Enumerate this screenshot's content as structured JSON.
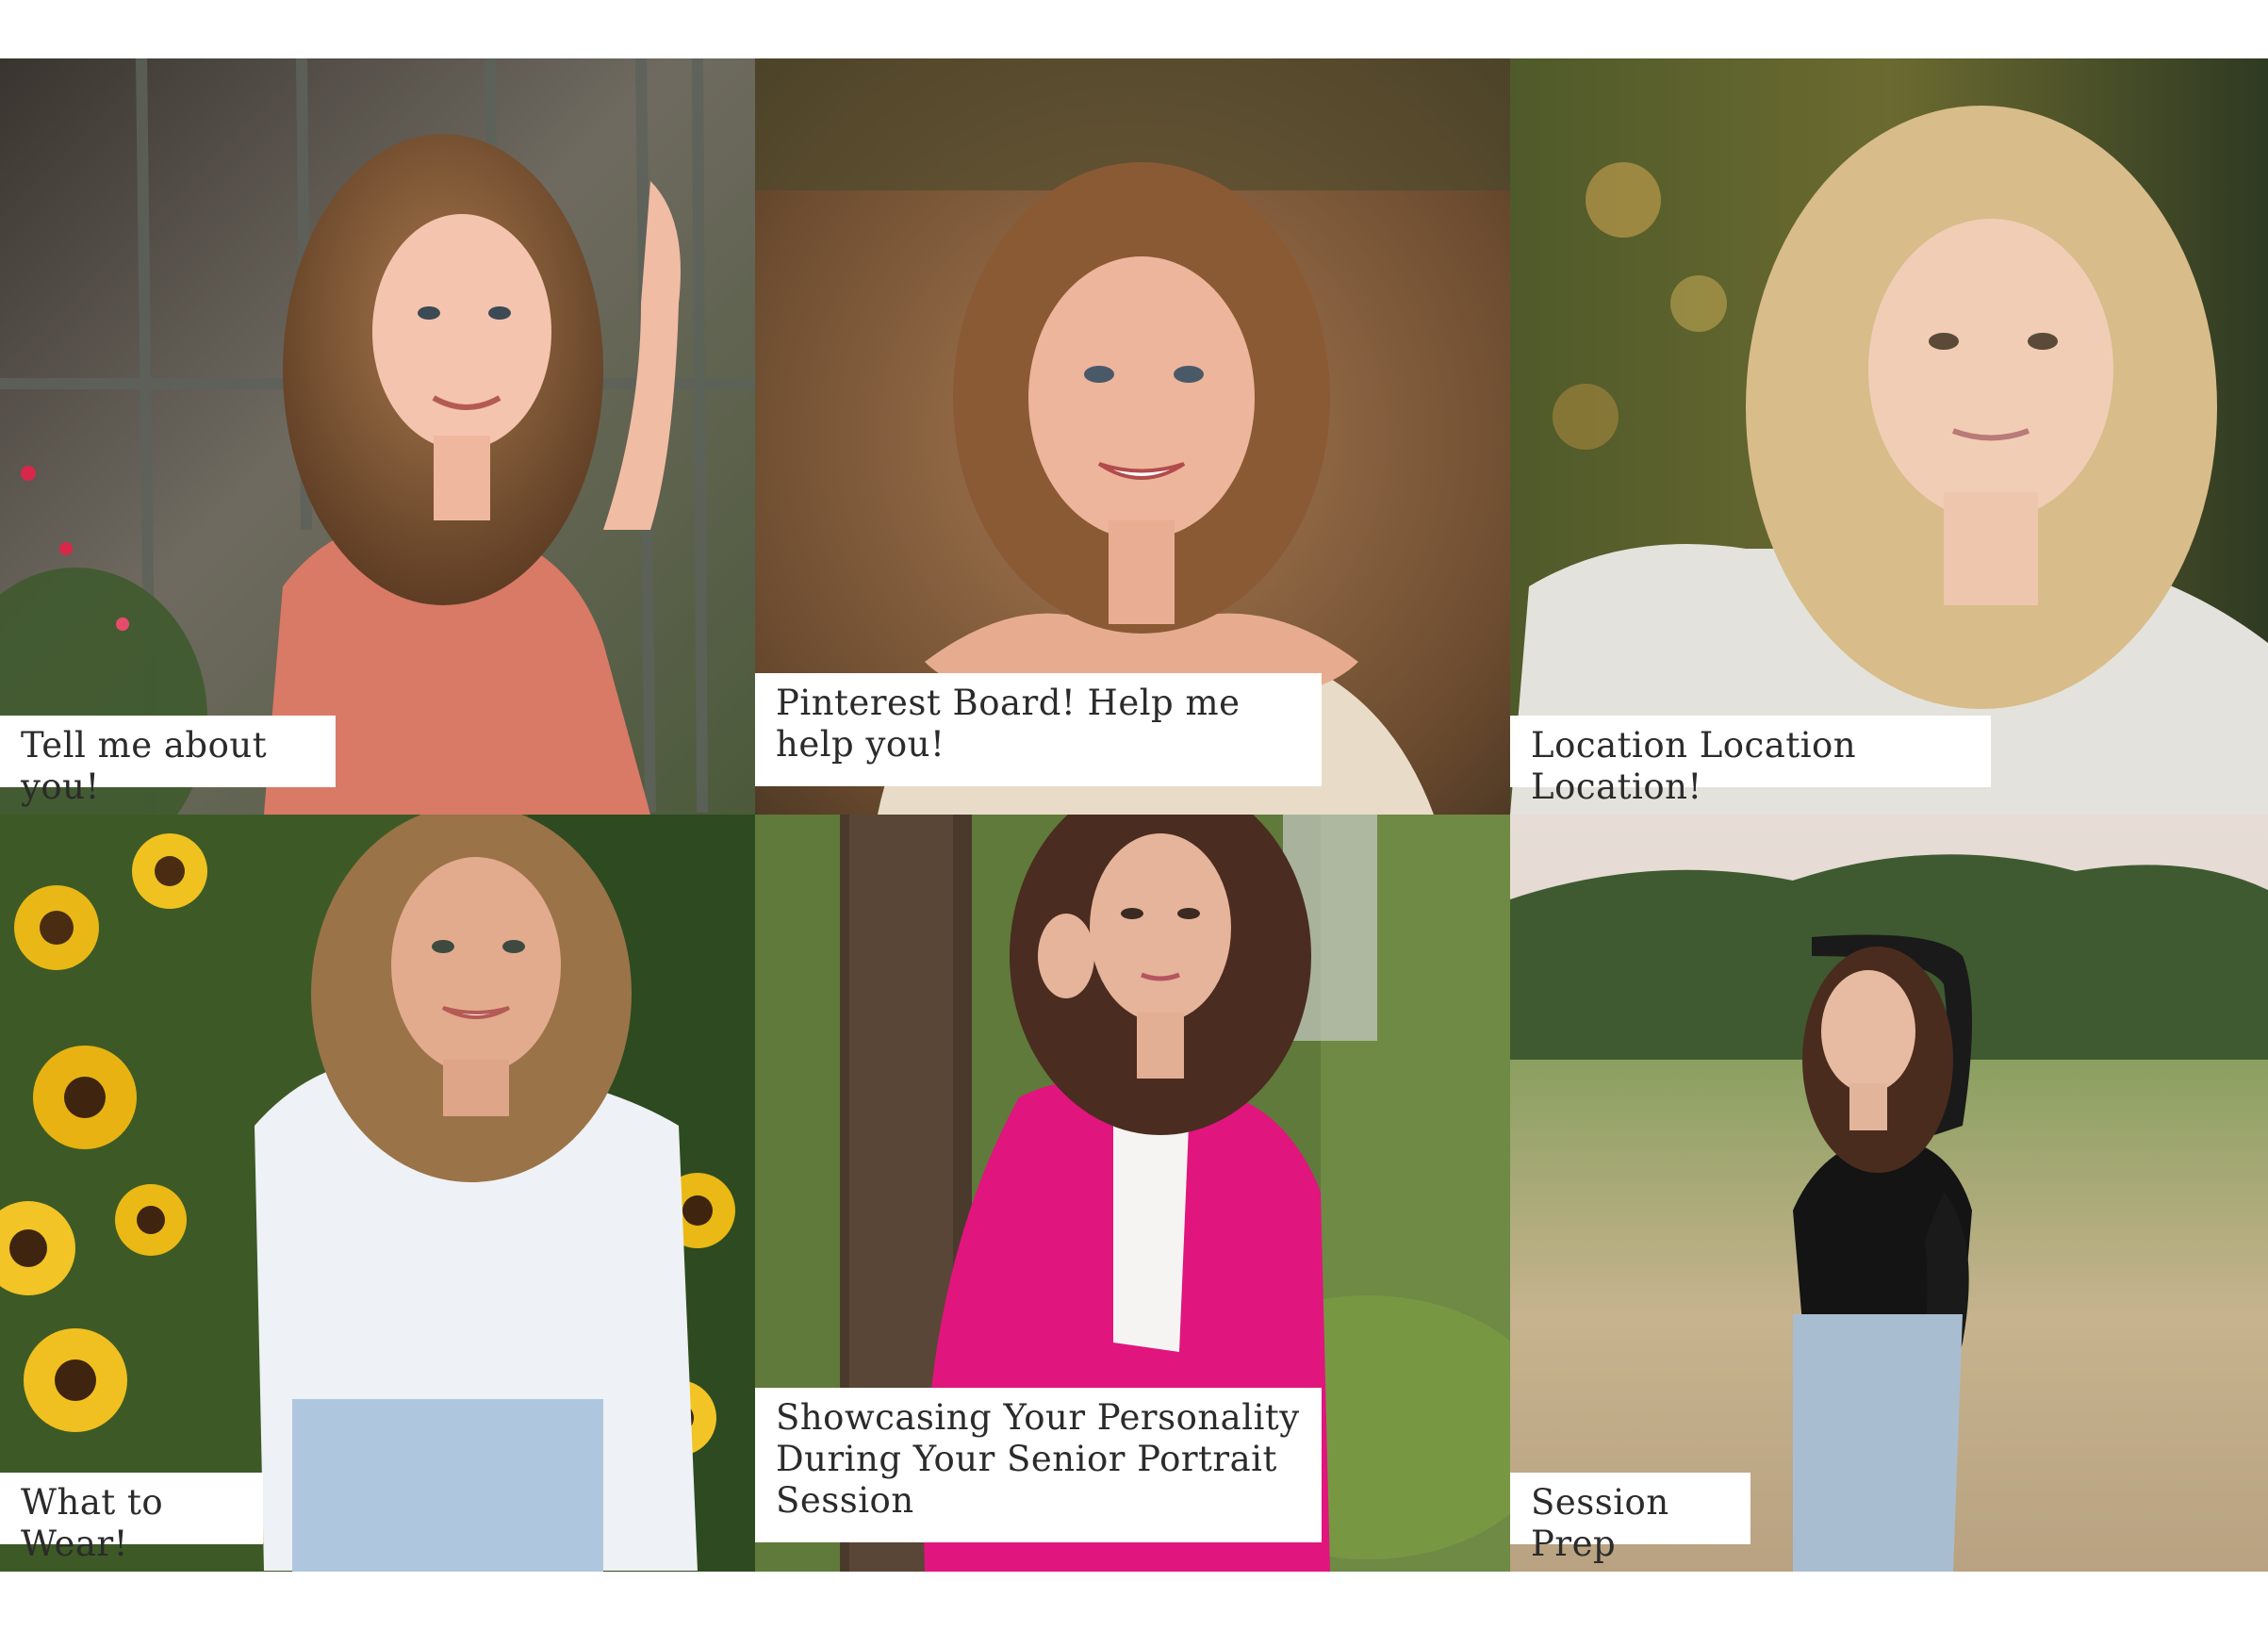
{
  "tiles": [
    {
      "caption": "Tell me about you!",
      "icon": "portrait-photo-icon"
    },
    {
      "caption": "Pinterest Board! Help me help you!",
      "icon": "portrait-photo-icon"
    },
    {
      "caption": "Location Location Location!",
      "icon": "portrait-photo-icon"
    },
    {
      "caption": "What to Wear!",
      "icon": "portrait-photo-icon"
    },
    {
      "caption": "Showcasing Your Personality During Your Senior Portrait Session",
      "icon": "portrait-photo-icon"
    },
    {
      "caption": "Session Prep",
      "icon": "portrait-photo-icon"
    }
  ],
  "colors": {
    "background": "#ffffff",
    "caption_bg": "#ffffff",
    "caption_text": "#2b2b2b"
  }
}
